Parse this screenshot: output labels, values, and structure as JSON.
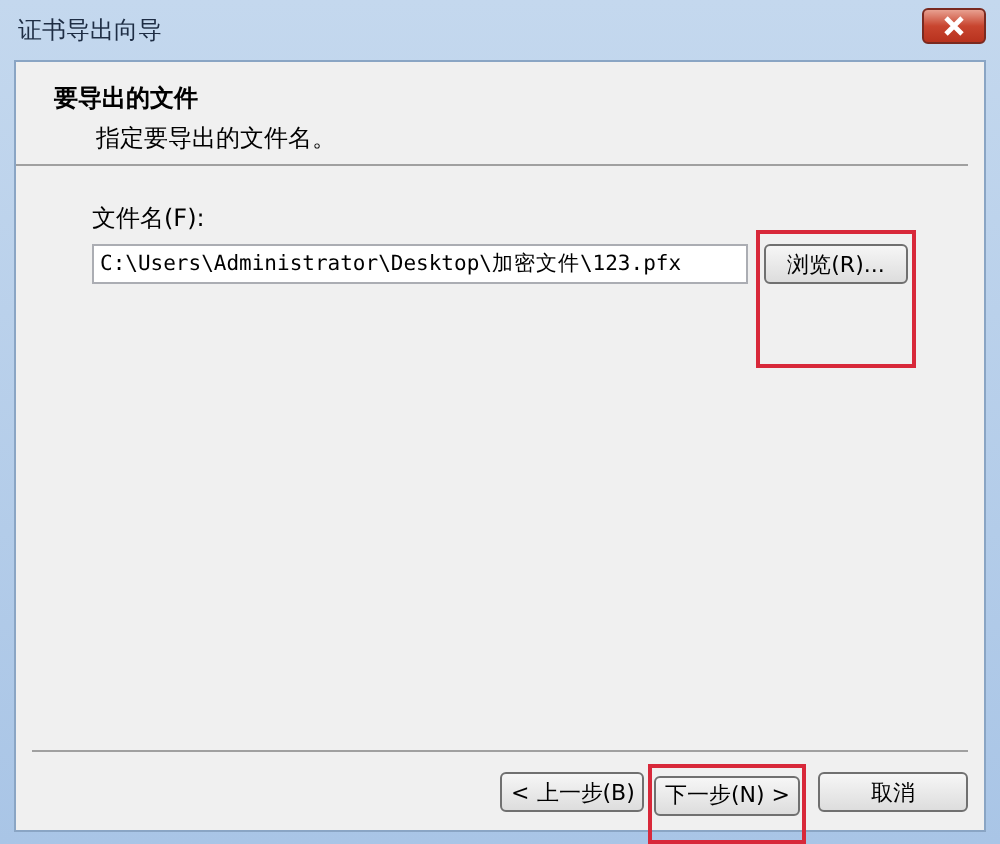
{
  "window": {
    "title": "证书导出向导"
  },
  "header": {
    "title": "要导出的文件",
    "subtitle": "指定要导出的文件名。"
  },
  "file_field": {
    "label": "文件名(F):",
    "value": "C:\\Users\\Administrator\\Desktop\\加密文件\\123.pfx"
  },
  "browse_button": {
    "label": "浏览(R)..."
  },
  "buttons": [
    {
      "label": "< 上一步(B)",
      "kind": "back"
    },
    {
      "label": "下一步(N) >",
      "kind": "next"
    },
    {
      "label": "取消",
      "kind": "cancel"
    }
  ]
}
